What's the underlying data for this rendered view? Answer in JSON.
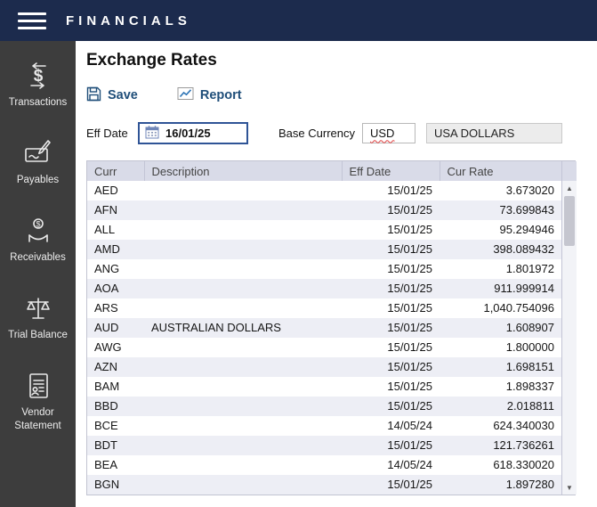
{
  "topbar": {
    "title": "FINANCIALS"
  },
  "sidebar": {
    "items": [
      {
        "label": "Transactions",
        "icon": "dollar-transfer-icon"
      },
      {
        "label": "Payables",
        "icon": "cheque-pen-icon"
      },
      {
        "label": "Receivables",
        "icon": "hand-coin-icon"
      },
      {
        "label": "Trial Balance",
        "icon": "balance-scale-icon"
      },
      {
        "label": "Vendor Statement",
        "icon": "vendor-document-icon"
      }
    ]
  },
  "main": {
    "title": "Exchange Rates",
    "toolbar": {
      "save_label": "Save",
      "report_label": "Report"
    },
    "form": {
      "eff_date_label": "Eff Date",
      "eff_date_value": "16/01/25",
      "base_currency_label": "Base Currency",
      "base_currency_value": "USD",
      "base_currency_name": "USA DOLLARS"
    },
    "table": {
      "headers": [
        "Curr",
        "Description",
        "Eff Date",
        "Cur Rate"
      ],
      "rows": [
        {
          "curr": "AED",
          "description": "",
          "eff_date": "15/01/25",
          "rate": "3.673020"
        },
        {
          "curr": "AFN",
          "description": "",
          "eff_date": "15/01/25",
          "rate": "73.699843"
        },
        {
          "curr": "ALL",
          "description": "",
          "eff_date": "15/01/25",
          "rate": "95.294946"
        },
        {
          "curr": "AMD",
          "description": "",
          "eff_date": "15/01/25",
          "rate": "398.089432"
        },
        {
          "curr": "ANG",
          "description": "",
          "eff_date": "15/01/25",
          "rate": "1.801972"
        },
        {
          "curr": "AOA",
          "description": "",
          "eff_date": "15/01/25",
          "rate": "911.999914"
        },
        {
          "curr": "ARS",
          "description": "",
          "eff_date": "15/01/25",
          "rate": "1,040.754096"
        },
        {
          "curr": "AUD",
          "description": "AUSTRALIAN DOLLARS",
          "eff_date": "15/01/25",
          "rate": "1.608907"
        },
        {
          "curr": "AWG",
          "description": "",
          "eff_date": "15/01/25",
          "rate": "1.800000"
        },
        {
          "curr": "AZN",
          "description": "",
          "eff_date": "15/01/25",
          "rate": "1.698151"
        },
        {
          "curr": "BAM",
          "description": "",
          "eff_date": "15/01/25",
          "rate": "1.898337"
        },
        {
          "curr": "BBD",
          "description": "",
          "eff_date": "15/01/25",
          "rate": "2.018811"
        },
        {
          "curr": "BCE",
          "description": "",
          "eff_date": "14/05/24",
          "rate": "624.340030"
        },
        {
          "curr": "BDT",
          "description": "",
          "eff_date": "15/01/25",
          "rate": "121.736261"
        },
        {
          "curr": "BEA",
          "description": "",
          "eff_date": "14/05/24",
          "rate": "618.330020"
        },
        {
          "curr": "BGN",
          "description": "",
          "eff_date": "15/01/25",
          "rate": "1.897280"
        }
      ]
    }
  },
  "scrollbar": {
    "up_glyph": "▲",
    "down_glyph": "▼"
  }
}
